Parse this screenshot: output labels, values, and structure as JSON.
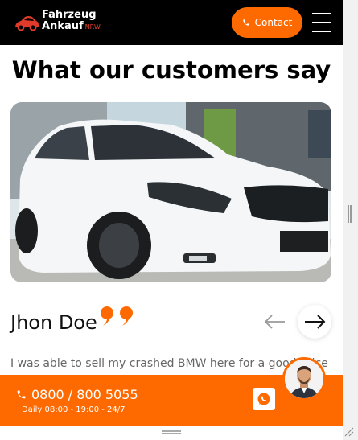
{
  "header": {
    "logo_line1": "Fahrzeug",
    "logo_line2": "Ankauf",
    "logo_suffix": "NRW",
    "contact_label": "Contact"
  },
  "section": {
    "title": "What our customers say"
  },
  "testimonial": {
    "name": "Jhon Doe",
    "review_text": "I was able to sell my crashed BMW here for a good price"
  },
  "contact_bar": {
    "phone": "0800 / 800 5055",
    "hours": "Daily 08:00 - 19:00 - 24/7"
  },
  "colors": {
    "accent": "#ff6a00",
    "header_bg": "#000000",
    "brand_red": "#e03a2a"
  },
  "icons": {
    "phone": "phone-icon",
    "menu": "hamburger-icon",
    "quote": "quote-icon",
    "prev": "arrow-left-icon",
    "next": "arrow-right-icon",
    "whatsapp": "whatsapp-icon"
  }
}
